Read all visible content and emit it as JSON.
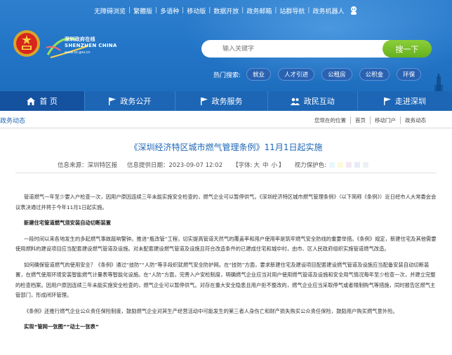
{
  "top_links": [
    "无障碍浏览",
    "繁體版",
    "多语种",
    "移动版",
    "数据开放",
    "政务邮箱",
    "站群导航",
    "政务机器人"
  ],
  "logo": {
    "name_cn": "深圳政府在线",
    "name_en": "SHENZHEN CHINA",
    "url": "www.sz.gov.cn"
  },
  "search": {
    "placeholder": "输入关键字",
    "button": "搜一下"
  },
  "hot": {
    "label": "热门搜索:",
    "tags": [
      "就业",
      "人才引进",
      "公租房",
      "公积金",
      "环保"
    ]
  },
  "nav": [
    {
      "label": "首 页",
      "icon": "home-icon"
    },
    {
      "label": "政务公开",
      "icon": "flag-icon"
    },
    {
      "label": "政务服务",
      "icon": "flag-icon"
    },
    {
      "label": "政民互动",
      "icon": "people-icon"
    },
    {
      "label": "走进深圳",
      "icon": "flag-icon"
    }
  ],
  "colors": {
    "header": "#2476c8",
    "nav": "#1d66b6",
    "nav_active": "#1452a0",
    "search_button": "#66b01f",
    "title": "#1d66b6"
  },
  "breadcrumb": {
    "section": "政务动态",
    "location_label": "您现在的位置",
    "items": [
      "首页",
      "移动门户",
      "政务动态"
    ]
  },
  "article": {
    "title": "《深圳经济特区城市燃气管理条例》11月1日起实施",
    "source": "信息来源：深圳特区报",
    "date": "信息提供日期：2023-09-07 12:02",
    "font_label": "【字体:",
    "font_sizes": [
      "大",
      "中",
      "小"
    ],
    "font_end": "】",
    "eye_label": "视力保护色:",
    "eye_colors": [
      "#e8f7fd",
      "#fdf9d8",
      "#f5e6f3",
      "#e4ecf6",
      "#eef1f3"
    ],
    "paragraphs": [
      {
        "type": "p",
        "text": "管道燃气一年至少要入户检查一次，因用户原因连续三年未能实施安全检查的，燃气企业可以暂停供气。《深圳经济特区城市燃气管理条例》（以下简称《条例》）近日经市人大常委会会议表决通过并将于今年11月1日起实施。"
      },
      {
        "type": "h",
        "text": "新建住宅管道燃气须安装自动切断装置"
      },
      {
        "type": "p",
        "text": "一段时间以来各地发生的多起燃气事故敲响警钟。推进“瓶改管”工程，切实提高管道天然气的覆盖率和用户使用率是筑牢燃气安全防线的重要举措。《条例》规定，新建住宅及其他需要使用燃料的建设项目应当配套建设燃气管道及设施。对未配套建设燃气管道及设施且符合改造条件的已建成住宅和城中村，由市、区人民政府组织实施管道燃气改造。"
      },
      {
        "type": "p",
        "text": "如何确保管道燃气的使用安全？《条例》通过“技防”“人防”等手段织就燃气安全防护网。在“技防”方面，要求新建住宅及建设项目配套建设燃气管道及设施应当配备安装自动切断装置，在燃气使用环境安装智能燃气计量表等智能化设施。在“人防”方面，完善入户安检制度，明确燃气企业应当对用户使用燃气管道及设施和安全用气情况每年至少检查一次，并建立完整的检查档案。因用户原因连续三年未能实施安全检查的，燃气企业可以暂停供气。对存在重大安全隐患且用户拒不整改的，燃气企业应当采取停气或者限制购气等措施，同时报告区燃气主管部门，形成闭环管理。"
      },
      {
        "type": "p",
        "text": "《条例》还推行燃气企业公众责任保险制度，鼓励燃气企业对其生产经营活动中可能发生的第三者人身伤亡和财产损失购买公众责任保险，鼓励用户购买燃气意外险。"
      },
      {
        "type": "h",
        "text": "实现“管网一张图”“动土一张表”"
      }
    ]
  }
}
